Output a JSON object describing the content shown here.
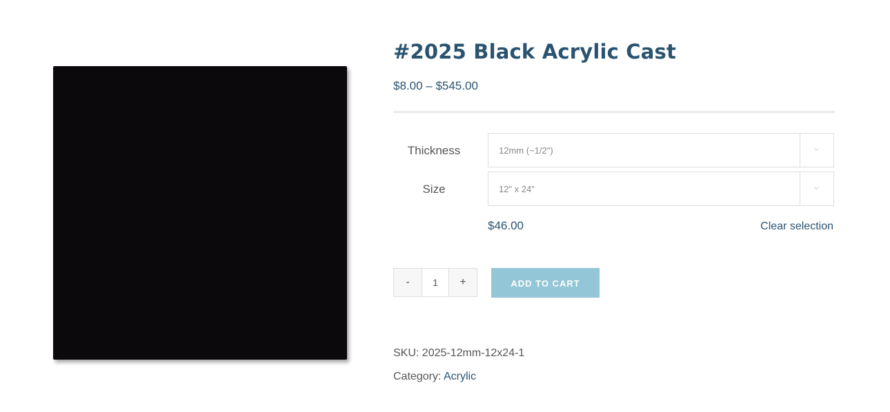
{
  "product": {
    "title": "#2025 Black Acrylic Cast",
    "price_range": "$8.00 – $545.00",
    "image_alt": "Black acrylic sheet",
    "image_color": "#0b090b"
  },
  "variations": {
    "thickness": {
      "label": "Thickness",
      "selected": "12mm (~1/2\")"
    },
    "size": {
      "label": "Size",
      "selected": "12\" x 24\""
    },
    "price": "$46.00",
    "clear_label": "Clear selection"
  },
  "cart": {
    "minus_label": "-",
    "quantity": "1",
    "plus_label": "+",
    "add_to_cart_label": "ADD TO CART",
    "button_color": "#93c6d6"
  },
  "meta": {
    "sku_label": "SKU:",
    "sku_value": "2025-12mm-12x24-1",
    "category_label": "Category:",
    "category_value": "Acrylic"
  },
  "colors": {
    "accent": "#2a5370",
    "text": "#555555"
  }
}
